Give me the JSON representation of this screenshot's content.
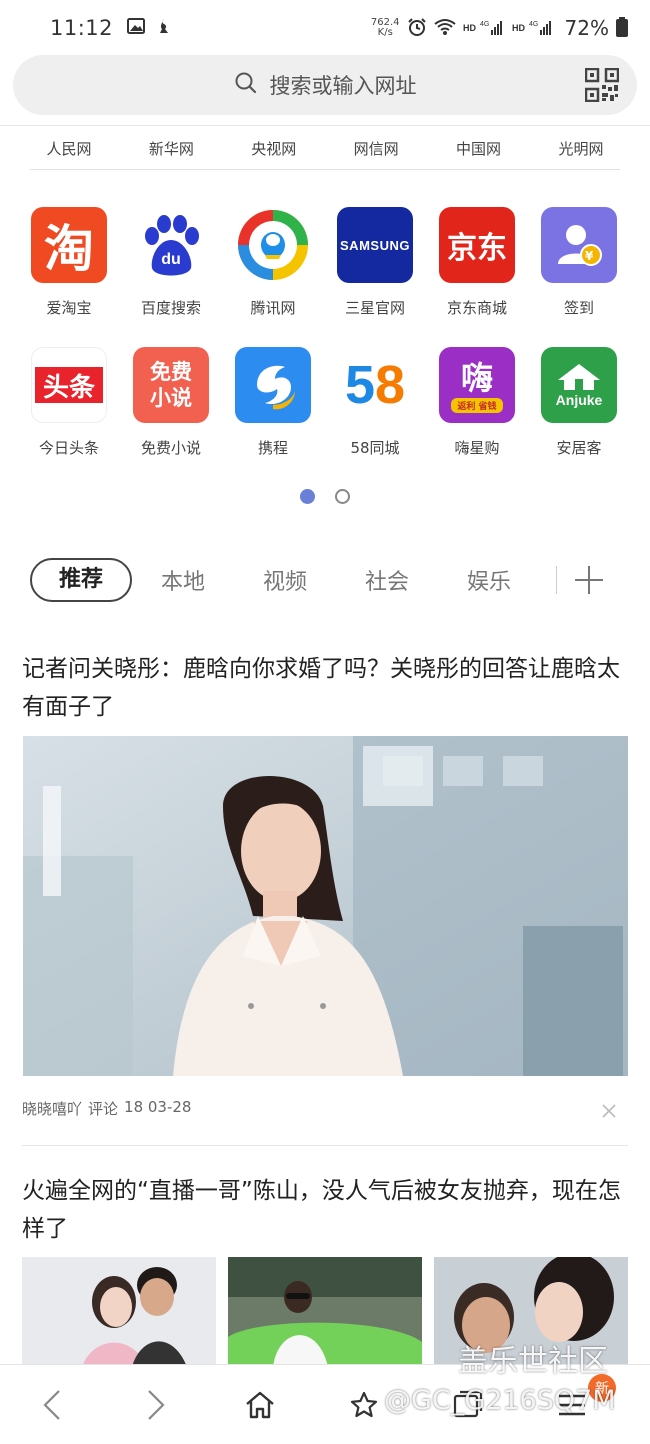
{
  "status_bar": {
    "time": "11:12",
    "net_speed_value": "762.4",
    "net_speed_unit": "K/s",
    "battery": "72%"
  },
  "search": {
    "placeholder": "搜索或输入网址"
  },
  "quick_links": [
    "人民网",
    "新华网",
    "央视网",
    "网信网",
    "中国网",
    "光明网"
  ],
  "apps": [
    {
      "label": "爱淘宝",
      "icon": "taobao-icon",
      "icon_text": "淘"
    },
    {
      "label": "百度搜索",
      "icon": "baidu-icon",
      "icon_text": "du"
    },
    {
      "label": "腾讯网",
      "icon": "tencent-icon",
      "icon_text": ""
    },
    {
      "label": "三星官网",
      "icon": "samsung-icon",
      "icon_text": "SAMSUNG"
    },
    {
      "label": "京东商城",
      "icon": "jd-icon",
      "icon_text": "京东"
    },
    {
      "label": "签到",
      "icon": "checkin-icon",
      "icon_text": "¥"
    },
    {
      "label": "今日头条",
      "icon": "toutiao-icon",
      "icon_text": "头条"
    },
    {
      "label": "免费小说",
      "icon": "novel-icon",
      "icon_text_1": "免费",
      "icon_text_2": "小说"
    },
    {
      "label": "携程",
      "icon": "ctrip-icon",
      "icon_text": ""
    },
    {
      "label": "58同城",
      "icon": "58-icon",
      "icon_text_1": "5",
      "icon_text_2": "8"
    },
    {
      "label": "嗨星购",
      "icon": "haixing-icon",
      "icon_text": "嗨",
      "icon_sub": "返利 省钱"
    },
    {
      "label": "安居客",
      "icon": "anjuke-icon",
      "icon_text": "Anjuke"
    }
  ],
  "tabs": [
    "推荐",
    "本地",
    "视频",
    "社会",
    "娱乐"
  ],
  "news": [
    {
      "title": "记者问关晓彤：鹿晗向你求婚了吗？关晓彤的回答让鹿晗太有面子了",
      "source": "晓晓嘻吖",
      "comment_label": "评论",
      "date": "18 03-28"
    },
    {
      "title": "火遍全网的“直播一哥”陈山，没人气后被女友抛弃，现在怎样了"
    }
  ],
  "bottom_nav": {
    "badge": "新"
  },
  "watermark": {
    "line1": "盖乐世社区",
    "line2": "@GC_G216SQ7M"
  },
  "colors": {
    "taobao": "#f04a22",
    "baidu": "#2a3bd0",
    "samsung": "#1428a0",
    "jd": "#e1251b",
    "checkin": "#7b73e3",
    "toutiao": "#e8232b",
    "novel": "#f26150",
    "ctrip": "#2d8cf0",
    "haixing": "#9b2fc5",
    "anjuke": "#2fa04a",
    "dot_active": "#6a7fd8"
  }
}
